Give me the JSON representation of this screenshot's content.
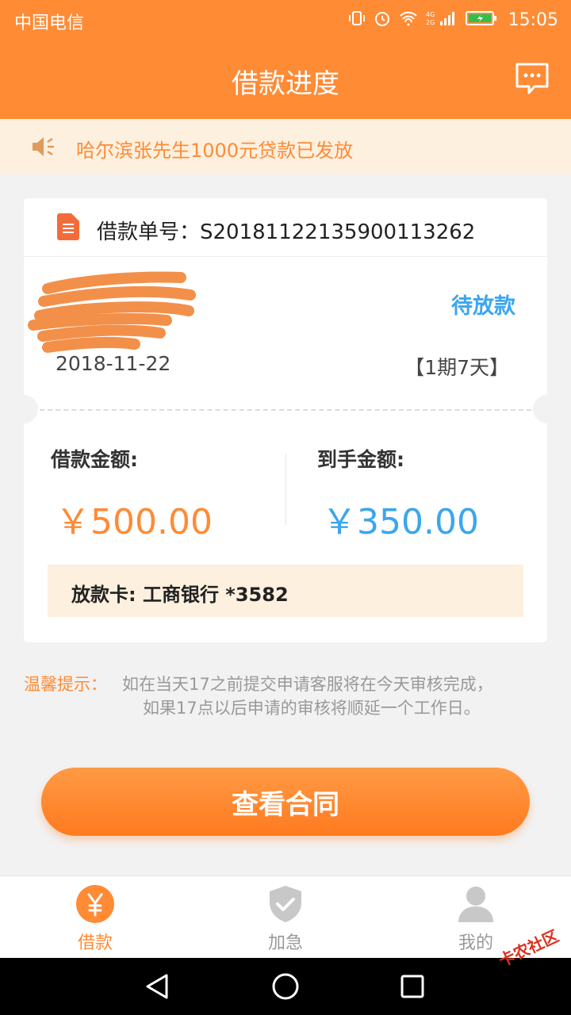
{
  "status_bar": {
    "carrier": "中国电信",
    "time": "15:05",
    "icons": [
      "vibrate-icon",
      "alarm-icon",
      "wifi-icon",
      "signal-icon",
      "battery-icon"
    ]
  },
  "header": {
    "title": "借款进度",
    "message_icon": "message-icon"
  },
  "notice": {
    "text": "哈尔滨张先生1000元贷款已发放",
    "icon": "speaker-icon"
  },
  "loan_card": {
    "order_label": "借款单号：S20181122135900113262",
    "status": "待放款",
    "date": "2018-11-22",
    "period": "【1期7天】",
    "loan_amount_label": "借款金额:",
    "loan_amount": "￥500.00",
    "received_amount_label": "到手金额:",
    "received_amount": "￥350.00",
    "bank_card": "放款卡: 工商银行 *3582",
    "colors": {
      "accent": "#ff8b35",
      "blue": "#3aa6ee"
    }
  },
  "tip": {
    "label": "温馨提示：",
    "line1": "如在当天17之前提交申请客服将在今天审核完成，",
    "line2": "如果17点以后申请的审核将顺延一个工作日。"
  },
  "actions": {
    "view_contract": "查看合同"
  },
  "tabs": [
    {
      "label": "借款",
      "icon": "yuan-icon",
      "active": true
    },
    {
      "label": "加急",
      "icon": "shield-check-icon",
      "active": false
    },
    {
      "label": "我的",
      "icon": "user-icon",
      "active": false
    }
  ],
  "watermark": "卡农社区"
}
